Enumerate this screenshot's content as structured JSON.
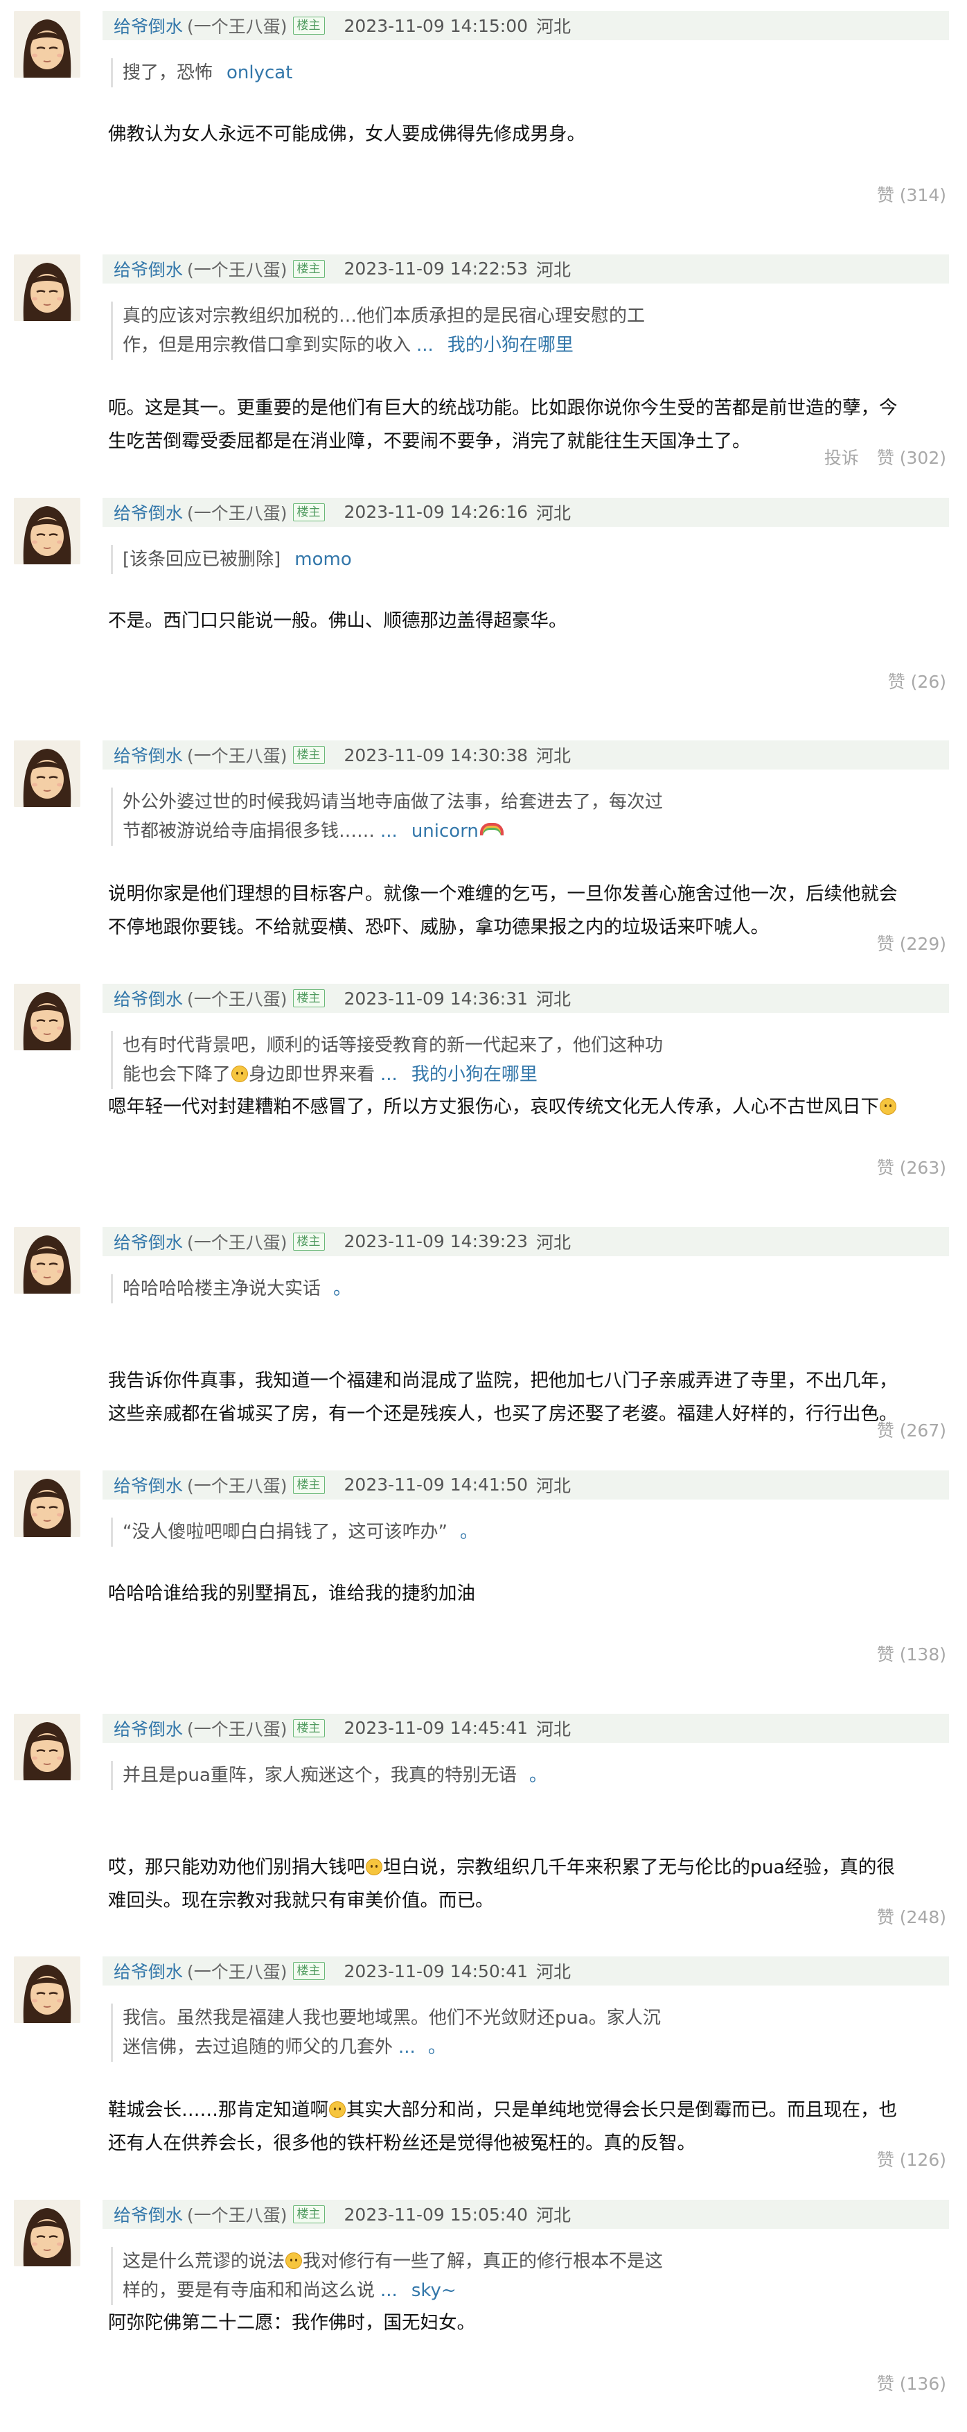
{
  "colors": {
    "link": "#3377aa",
    "header_bg": "#f0f4ef",
    "op_badge": "#4f9a5e",
    "muted": "#a8a8a8"
  },
  "comments": [
    {
      "author": "给爷倒水",
      "nick": "(一个王八蛋)",
      "badge": "楼主",
      "time": "2023-11-09 14:15:00",
      "location": "河北",
      "quote": {
        "lines": [
          "搜了，恐怖"
        ],
        "dots": "",
        "quote_author": "onlycat",
        "emoji": ""
      },
      "body": [
        "佛教认为女人永远不可能成佛，女人要成佛得先修成男身。"
      ],
      "body_emoji_after": "",
      "report": "",
      "like": "赞 (314)"
    },
    {
      "author": "给爷倒水",
      "nick": "(一个王八蛋)",
      "badge": "楼主",
      "time": "2023-11-09 14:22:53",
      "location": "河北",
      "quote": {
        "lines": [
          "真的应该对宗教组织加税的…他们本质承担的是民宿心理安慰的工",
          "作，但是用宗教借口拿到实际的收入"
        ],
        "dots": "...",
        "quote_author": "我的小狗在哪里",
        "emoji": ""
      },
      "body": [
        "呃。这是其一。更重要的是他们有巨大的统战功能。比如跟你说你今生受的苦都是前世造的孽，今",
        "生吃苦倒霉受委屈都是在消业障，不要闹不要争，消完了就能往生天国净土了。"
      ],
      "body_emoji_after": "",
      "report": "投诉",
      "like": "赞 (302)"
    },
    {
      "author": "给爷倒水",
      "nick": "(一个王八蛋)",
      "badge": "楼主",
      "time": "2023-11-09 14:26:16",
      "location": "河北",
      "quote": {
        "lines": [
          "[该条回应已被删除]"
        ],
        "dots": "",
        "quote_author": "momo",
        "emoji": ""
      },
      "body": [
        "不是。西门口只能说一般。佛山、顺德那边盖得超豪华。"
      ],
      "body_emoji_after": "",
      "report": "",
      "like": "赞 (26)"
    },
    {
      "author": "给爷倒水",
      "nick": "(一个王八蛋)",
      "badge": "楼主",
      "time": "2023-11-09 14:30:38",
      "location": "河北",
      "quote": {
        "lines": [
          "外公外婆过世的时候我妈请当地寺庙做了法事，给套进去了，每次过",
          "节都被游说给寺庙捐很多钱……"
        ],
        "dots": "...",
        "quote_author": "unicorn",
        "emoji": "rainbow"
      },
      "body": [
        "说明你家是他们理想的目标客户。就像一个难缠的乞丐，一旦你发善心施舍过他一次，后续他就会",
        "不停地跟你要钱。不给就耍横、恐吓、威胁，拿功德果报之内的垃圾话来吓唬人。"
      ],
      "body_emoji_after": "",
      "report": "",
      "like": "赞 (229)"
    },
    {
      "author": "给爷倒水",
      "nick": "(一个王八蛋)",
      "badge": "楼主",
      "time": "2023-11-09 14:36:31",
      "location": "河北",
      "quote": {
        "lines": [
          "也有时代背景吧，顺利的话等接受教育的新一代起来了，他们这种功",
          "能也会下降了|身边即世界来看"
        ],
        "dots": "...",
        "quote_author": "我的小狗在哪里",
        "emoji": ""
      },
      "body": [
        "嗯年轻一代对封建糟粕不感冒了，所以方丈狠伤心，哀叹传统文化无人传承，人心不古世风日下"
      ],
      "body_emoji_after": "face",
      "report": "",
      "like": "赞 (263)"
    },
    {
      "author": "给爷倒水",
      "nick": "(一个王八蛋)",
      "badge": "楼主",
      "time": "2023-11-09 14:39:23",
      "location": "河北",
      "quote": {
        "lines": [
          "哈哈哈哈楼主净说大实话"
        ],
        "dots": "",
        "quote_author": "。",
        "emoji": ""
      },
      "body": [
        "我告诉你件真事，我知道一个福建和尚混成了监院，把他加七八门子亲戚弄进了寺里，不出几年，",
        "这些亲戚都在省城买了房，有一个还是残疾人，也买了房还娶了老婆。福建人好样的，行行出色。"
      ],
      "body_emoji_after": "",
      "report": "",
      "like": "赞 (267)"
    },
    {
      "author": "给爷倒水",
      "nick": "(一个王八蛋)",
      "badge": "楼主",
      "time": "2023-11-09 14:41:50",
      "location": "河北",
      "quote": {
        "lines": [
          "“没人傻啦吧唧白白捐钱了，这可该咋办”"
        ],
        "dots": "",
        "quote_author": "。",
        "emoji": ""
      },
      "body": [
        "哈哈哈谁给我的别墅捐瓦，谁给我的捷豹加油"
      ],
      "body_emoji_after": "",
      "report": "",
      "like": "赞 (138)"
    },
    {
      "author": "给爷倒水",
      "nick": "(一个王八蛋)",
      "badge": "楼主",
      "time": "2023-11-09 14:45:41",
      "location": "河北",
      "quote": {
        "lines": [
          "并且是pua重阵，家人痴迷这个，我真的特别无语"
        ],
        "dots": "",
        "quote_author": "。",
        "emoji": ""
      },
      "body": [
        "哎，那只能劝劝他们别捐大钱吧|坦白说，宗教组织几千年来积累了无与伦比的pua经验，真的很",
        "难回头。现在宗教对我就只有审美价值。而已。"
      ],
      "body_emoji_after": "",
      "report": "",
      "like": "赞 (248)"
    },
    {
      "author": "给爷倒水",
      "nick": "(一个王八蛋)",
      "badge": "楼主",
      "time": "2023-11-09 14:50:41",
      "location": "河北",
      "quote": {
        "lines": [
          "我信。虽然我是福建人我也要地域黑。他们不光敛财还pua。家人沉",
          "迷信佛，去过追随的师父的几套外"
        ],
        "dots": "...",
        "quote_author": "。",
        "emoji": ""
      },
      "body": [
        "鞋城会长……那肯定知道啊|其实大部分和尚，只是单纯地觉得会长只是倒霉而已。而且现在，也",
        "还有人在供养会长，很多他的铁杆粉丝还是觉得他被冤枉的。真的反智。"
      ],
      "body_emoji_after": "",
      "report": "",
      "like": "赞 (126)"
    },
    {
      "author": "给爷倒水",
      "nick": "(一个王八蛋)",
      "badge": "楼主",
      "time": "2023-11-09 15:05:40",
      "location": "河北",
      "quote": {
        "lines": [
          "这是什么荒谬的说法|我对修行有一些了解，真正的修行根本不是这",
          "样的，要是有寺庙和和尚这么说"
        ],
        "dots": "...",
        "quote_author": "sky~",
        "emoji": ""
      },
      "body": [
        "阿弥陀佛第二十二愿：我作佛时，国无妇女。"
      ],
      "body_emoji_after": "",
      "report": "",
      "like": "赞 (136)"
    }
  ]
}
